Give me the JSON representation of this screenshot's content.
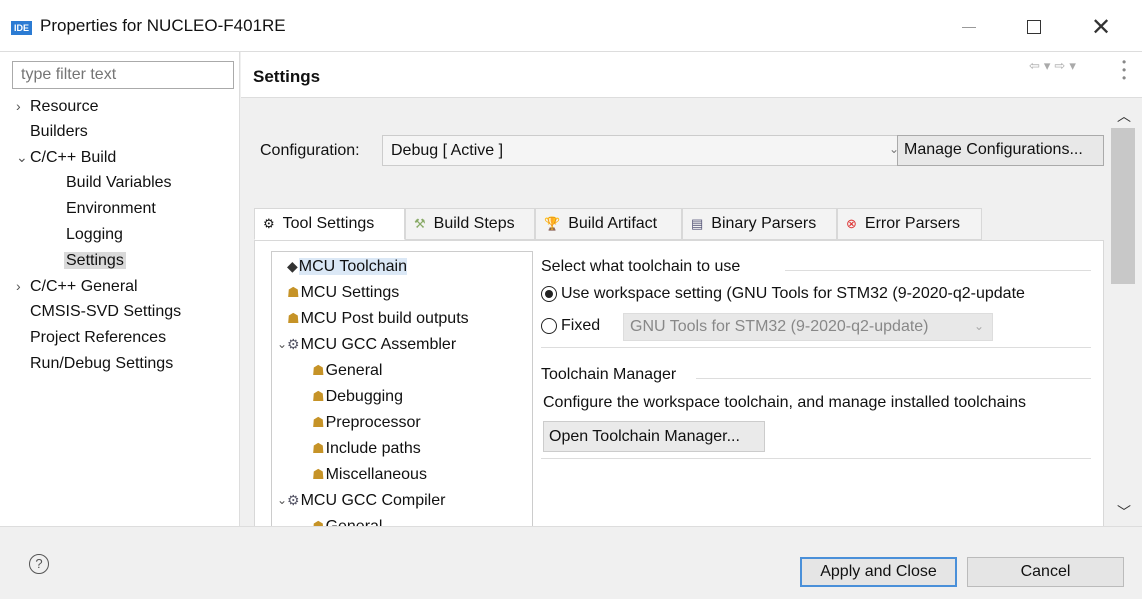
{
  "window": {
    "icon_text": "IDE",
    "title": "Properties for NUCLEO-F401RE"
  },
  "filter": {
    "placeholder": "type filter text"
  },
  "nav": [
    {
      "label": "Resource",
      "chevron": "›"
    },
    {
      "label": "Builders"
    },
    {
      "label": "C/C++ Build",
      "chevron": "⌄"
    },
    {
      "label": "Build Variables"
    },
    {
      "label": "Environment"
    },
    {
      "label": "Logging"
    },
    {
      "label": "Settings"
    },
    {
      "label": "C/C++ General",
      "chevron": "›"
    },
    {
      "label": "CMSIS-SVD Settings"
    },
    {
      "label": "Project References"
    },
    {
      "label": "Run/Debug Settings"
    }
  ],
  "page": {
    "title": "Settings"
  },
  "configuration": {
    "label": "Configuration:",
    "value": "Debug  [ Active ]",
    "manage_label": "Manage Configurations..."
  },
  "tabs": [
    {
      "label": "Tool Settings",
      "icon": "gear-icon"
    },
    {
      "label": "Build Steps",
      "icon": "hammer-icon"
    },
    {
      "label": "Build Artifact",
      "icon": "trophy-icon"
    },
    {
      "label": "Binary Parsers",
      "icon": "binary-icon"
    },
    {
      "label": "Error Parsers",
      "icon": "error-icon"
    }
  ],
  "tree": [
    {
      "label": "MCU Toolchain"
    },
    {
      "label": "MCU Settings"
    },
    {
      "label": "MCU Post build outputs"
    },
    {
      "label": "MCU GCC Assembler"
    },
    {
      "label": "General"
    },
    {
      "label": "Debugging"
    },
    {
      "label": "Preprocessor"
    },
    {
      "label": "Include paths"
    },
    {
      "label": "Miscellaneous"
    },
    {
      "label": "MCU GCC Compiler"
    },
    {
      "label": "General"
    }
  ],
  "toolchain": {
    "group_title": "Select what toolchain to use",
    "option_workspace": "Use workspace setting (GNU Tools for STM32 (9-2020-q2-update",
    "option_fixed": "Fixed",
    "fixed_value": "GNU Tools for STM32 (9-2020-q2-update)",
    "selected": "workspace"
  },
  "manager": {
    "group_title": "Toolchain Manager",
    "description": "Configure the workspace toolchain, and manage installed toolchains",
    "button": "Open Toolchain Manager..."
  },
  "footer": {
    "help": "?",
    "apply": "Apply and Close",
    "cancel": "Cancel"
  },
  "colors": {
    "accent": "#4a90d9",
    "selection": "#dbe8f6",
    "ide_icon": "#2b7bd3"
  }
}
